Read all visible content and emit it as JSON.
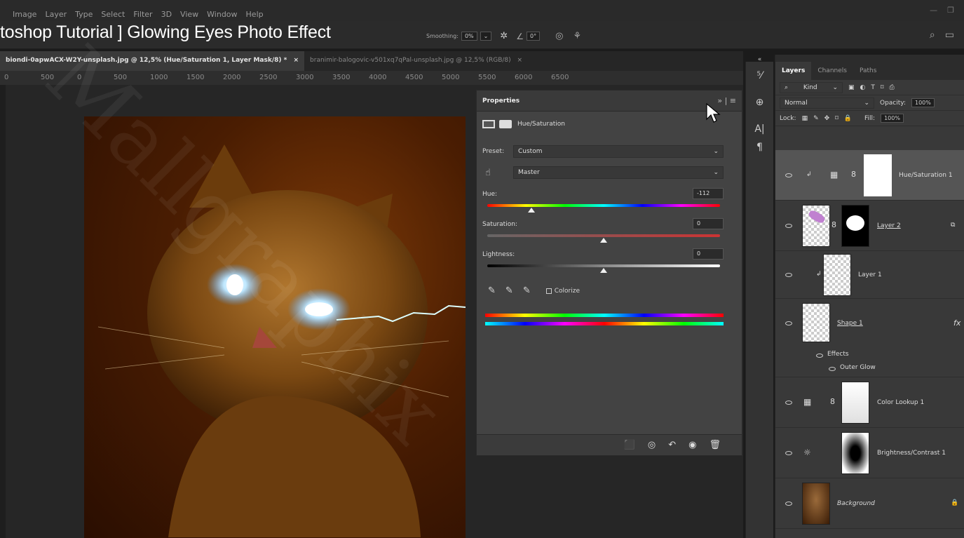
{
  "menu": [
    "Image",
    "Layer",
    "Type",
    "Select",
    "Filter",
    "3D",
    "View",
    "Window",
    "Help"
  ],
  "video_title": "toshop Tutorial ] Glowing Eyes Photo Effect",
  "options": {
    "smoothing_label": "Smoothing:",
    "smoothing_value": "0%",
    "angle_value": "0°"
  },
  "tabs": [
    {
      "label": "biondi-0apwACX-W2Y-unsplash.jpg @ 12,5% (Hue/Saturation 1, Layer Mask/8) *",
      "close": "×"
    },
    {
      "label": "branimir-balogovic-v501xq7qPal-unsplash.jpg @ 12,5% (RGB/8)",
      "close": "×"
    }
  ],
  "ruler": [
    "0",
    "500",
    "0",
    "500",
    "1000",
    "1500",
    "2000",
    "2500",
    "3000",
    "3500",
    "4000",
    "4500",
    "5000",
    "5500",
    "6000",
    "6500"
  ],
  "properties": {
    "title": "Properties",
    "adjustment": "Hue/Saturation",
    "preset_label": "Preset:",
    "preset_value": "Custom",
    "channel_value": "Master",
    "hue_label": "Hue:",
    "hue_value": "-112",
    "sat_label": "Saturation:",
    "sat_value": "0",
    "light_label": "Lightness:",
    "light_value": "0",
    "colorize_label": "Colorize"
  },
  "sliders": {
    "hue": -112,
    "saturation": 0,
    "lightness": 0
  },
  "layers_panel": {
    "tabs": [
      "Layers",
      "Channels",
      "Paths"
    ],
    "kind_label": "Kind",
    "blend_mode": "Normal",
    "opacity_label": "Opacity:",
    "opacity_value": "100%",
    "lock_label": "Lock:",
    "fill_label": "Fill:",
    "fill_value": "100%",
    "layers": [
      {
        "name": "Hue/Saturation 1"
      },
      {
        "name": "Layer 2"
      },
      {
        "name": "Layer 1"
      },
      {
        "name": "Shape 1",
        "fx": "fx"
      },
      {
        "name": "Color Lookup 1"
      },
      {
        "name": "Brightness/Contrast 1"
      },
      {
        "name": "Background"
      }
    ],
    "effects_label": "Effects",
    "outer_glow_label": "Outer Glow"
  },
  "watermark": "Mallgraphix"
}
